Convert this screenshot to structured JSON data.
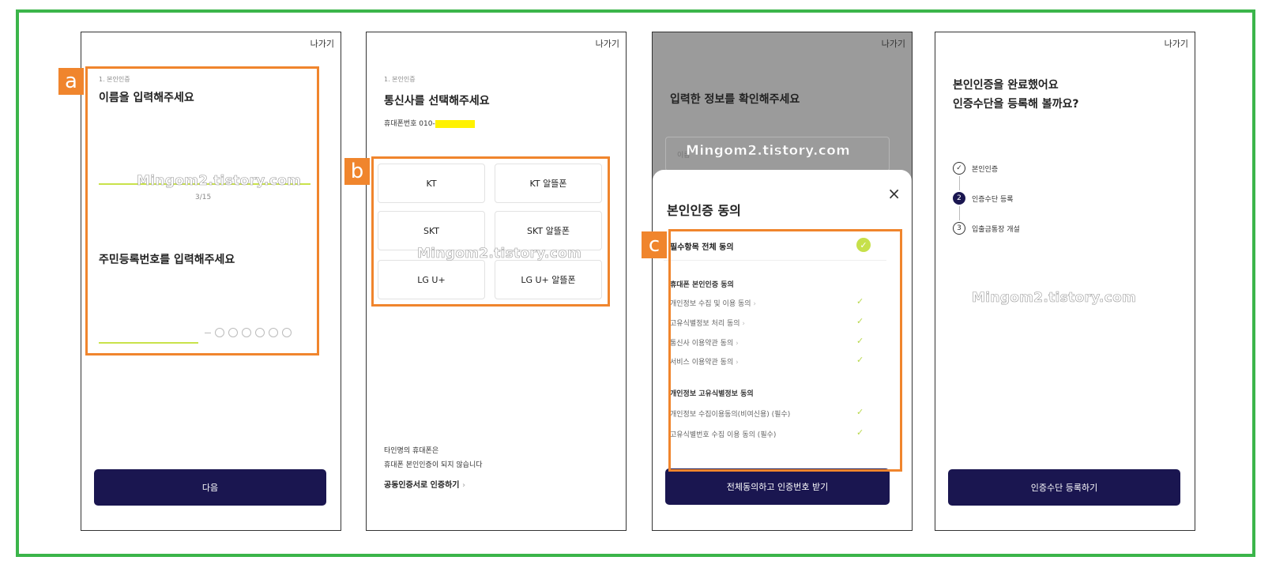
{
  "common": {
    "exit_label": "나가기",
    "step_label": "1. 본인인증",
    "watermark": "Mingom2.tistory.com"
  },
  "annotations": {
    "a": "a",
    "b": "b",
    "c": "c"
  },
  "screen1": {
    "title_name": "이름을 입력해주세요",
    "page_counter": "3/15",
    "title_rrn": "주민등록번호를 입력해주세요",
    "next_button": "다음"
  },
  "screen2": {
    "title": "통신사를 선택해주세요",
    "phone_label": "휴대폰번호 010-",
    "phone_masked": "xxxx-xxxx",
    "carriers": [
      "KT",
      "KT 알뜰폰",
      "SKT",
      "SKT 알뜰폰",
      "LG U+",
      "LG U+ 알뜰폰"
    ],
    "notice_line1": "타인명의 휴대폰은",
    "notice_line2": "휴대폰 본인인증이 되지 않습니다",
    "cert_link": "공동인증서로 인증하기"
  },
  "screen3": {
    "title": "입력한 정보를 확인해주세요",
    "name_label": "이름",
    "sheet_title": "본인인증 동의",
    "close_icon": "×",
    "all_agree": "필수항목 전체 동의",
    "section1_title": "휴대폰 본인인증 동의",
    "section1_items": [
      "개인정보 수집 및 이용 동의",
      "고유식별정보 처리 동의",
      "통신사 이용약관 동의",
      "서비스 이용약관 동의"
    ],
    "section2_title": "개인정보 고유식별정보 동의",
    "section2_items": [
      "개인정보 수집이용동의(비여신용) (필수)",
      "고유식별번호 수집 이용 동의 (필수)"
    ],
    "confirm_button": "전체동의하고 인증번호 받기"
  },
  "screen4": {
    "title_line1": "본인인증을 완료했어요",
    "title_line2": "인증수단을 등록해 볼까요?",
    "steps": [
      {
        "marker": "✓",
        "label": "본인인증"
      },
      {
        "marker": "2",
        "label": "인증수단 등록"
      },
      {
        "marker": "3",
        "label": "입출금통장 개설"
      }
    ],
    "register_button": "인증수단 등록하기"
  },
  "colors": {
    "frame_green": "#3bb54a",
    "annotation_orange": "#f0852d",
    "button_navy": "#1a1650",
    "accent_lime": "#c6e04a",
    "highlight_yellow": "#fff200"
  }
}
